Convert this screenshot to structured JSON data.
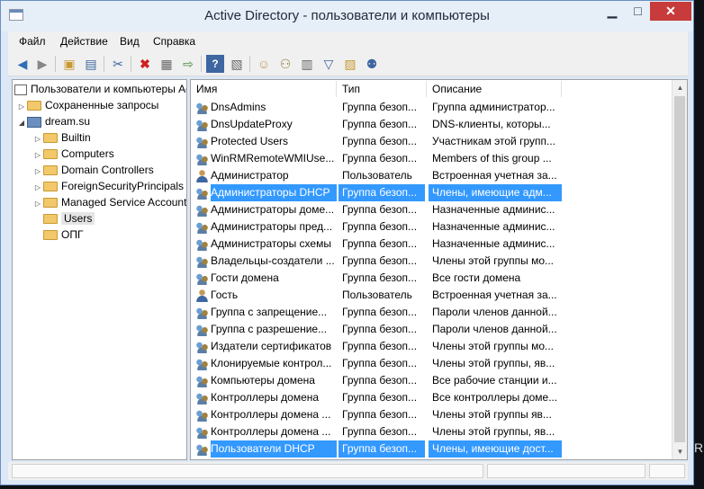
{
  "window": {
    "title": "Active Directory - пользователи и компьютеры",
    "min_label": "▁",
    "max_label": "□",
    "close_label": "✕"
  },
  "menu": [
    "Файл",
    "Действие",
    "Вид",
    "Справка"
  ],
  "tree": {
    "root": "Пользователи и компьютеры Active Directory",
    "saved_queries": "Сохраненные запросы",
    "domain": "dream.su",
    "children": [
      "Builtin",
      "Computers",
      "Domain Controllers",
      "ForeignSecurityPrincipals",
      "Managed Service Accounts",
      "Users",
      "ОПГ"
    ],
    "selected": "Users"
  },
  "list": {
    "columns": [
      "Имя",
      "Тип",
      "Описание"
    ],
    "rows": [
      {
        "name": "DnsAdmins",
        "type": "Группа безоп...",
        "desc": "Группа администратор...",
        "icon": "group"
      },
      {
        "name": "DnsUpdateProxy",
        "type": "Группа безоп...",
        "desc": "DNS-клиенты, которы...",
        "icon": "group"
      },
      {
        "name": "Protected Users",
        "type": "Группа безоп...",
        "desc": "Участникам этой групп...",
        "icon": "group"
      },
      {
        "name": "WinRMRemoteWMIUse...",
        "type": "Группа безоп...",
        "desc": "Members of this group ...",
        "icon": "group"
      },
      {
        "name": "Администратор",
        "type": "Пользователь",
        "desc": "Встроенная учетная за...",
        "icon": "user"
      },
      {
        "name": "Администраторы DHCP",
        "type": "Группа безоп...",
        "desc": "Члены, имеющие адм...",
        "icon": "group",
        "selected": true
      },
      {
        "name": "Администраторы доме...",
        "type": "Группа безоп...",
        "desc": "Назначенные админис...",
        "icon": "group"
      },
      {
        "name": "Администраторы пред...",
        "type": "Группа безоп...",
        "desc": "Назначенные админис...",
        "icon": "group"
      },
      {
        "name": "Администраторы схемы",
        "type": "Группа безоп...",
        "desc": "Назначенные админис...",
        "icon": "group"
      },
      {
        "name": "Владельцы-создатели ...",
        "type": "Группа безоп...",
        "desc": "Члены этой группы мо...",
        "icon": "group"
      },
      {
        "name": "Гости домена",
        "type": "Группа безоп...",
        "desc": "Все гости домена",
        "icon": "group"
      },
      {
        "name": "Гость",
        "type": "Пользователь",
        "desc": "Встроенная учетная за...",
        "icon": "user"
      },
      {
        "name": "Группа с запрещение...",
        "type": "Группа безоп...",
        "desc": "Пароли членов данной...",
        "icon": "group"
      },
      {
        "name": "Группа с разрешение...",
        "type": "Группа безоп...",
        "desc": "Пароли членов данной...",
        "icon": "group"
      },
      {
        "name": "Издатели сертификатов",
        "type": "Группа безоп...",
        "desc": "Члены этой группы мо...",
        "icon": "group"
      },
      {
        "name": "Клонируемые контрол...",
        "type": "Группа безоп...",
        "desc": "Члены этой группы, яв...",
        "icon": "group"
      },
      {
        "name": "Компьютеры домена",
        "type": "Группа безоп...",
        "desc": "Все рабочие станции и...",
        "icon": "group"
      },
      {
        "name": "Контроллеры домена",
        "type": "Группа безоп...",
        "desc": "Все контроллеры доме...",
        "icon": "group"
      },
      {
        "name": "Контроллеры домена ...",
        "type": "Группа безоп...",
        "desc": "Члены этой группы яв...",
        "icon": "group"
      },
      {
        "name": "Контроллеры домена ...",
        "type": "Группа безоп...",
        "desc": "Члены этой группы, яв...",
        "icon": "group"
      },
      {
        "name": "Пользователи DHCP",
        "type": "Группа безоп...",
        "desc": "Члены, имеющие дост...",
        "icon": "group",
        "selected": true
      }
    ]
  },
  "edge_char": "R",
  "colors": {
    "selection": "#3399ff",
    "titlebar": "#e6eef8",
    "close": "#c73b3b"
  }
}
